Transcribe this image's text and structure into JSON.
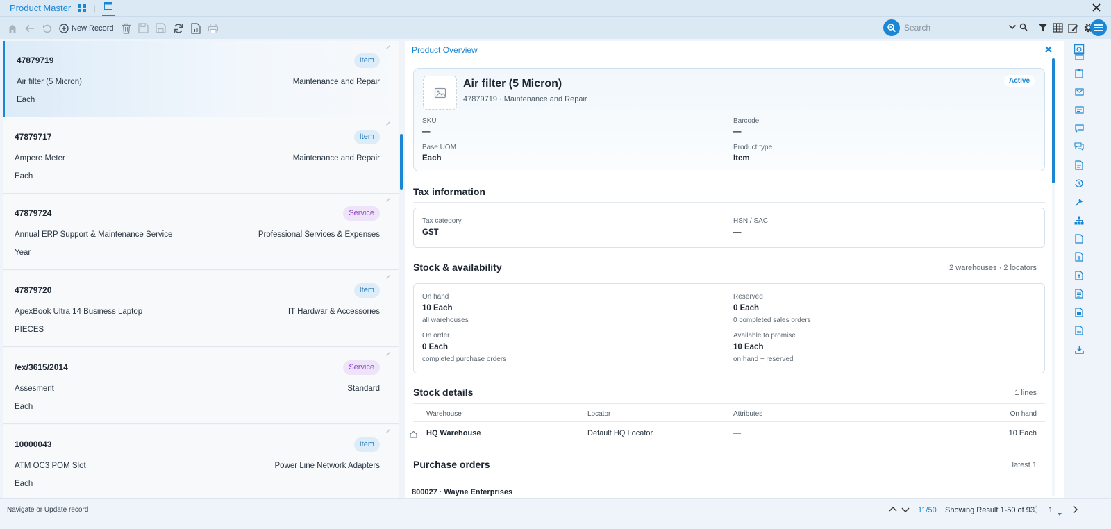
{
  "window": {
    "title": "Product Master"
  },
  "toolbar": {
    "new_record_label": "New Record",
    "search_placeholder": "Search"
  },
  "list": {
    "items": [
      {
        "code": "47879719",
        "type": "Item",
        "name": "Air filter (5 Micron)",
        "category": "Maintenance and Repair",
        "uom": "Each"
      },
      {
        "code": "47879717",
        "type": "Item",
        "name": "Ampere Meter",
        "category": "Maintenance and Repair",
        "uom": "Each"
      },
      {
        "code": "47879724",
        "type": "Service",
        "name": "Annual ERP Support & Maintenance Service",
        "category": "Professional Services & Expenses",
        "uom": "Year"
      },
      {
        "code": "47879720",
        "type": "Item",
        "name": "ApexBook Ultra 14 Business Laptop",
        "category": "IT Hardwar & Accessories",
        "uom": "PIECES"
      },
      {
        "code": "/ex/3615/2014",
        "type": "Service",
        "name": "Assesment",
        "category": "Standard",
        "uom": "Each"
      },
      {
        "code": "10000043",
        "type": "Item",
        "name": "ATM OC3 POM Slot",
        "category": "Power Line Network Adapters",
        "uom": "Each"
      }
    ]
  },
  "detail": {
    "panel_title": "Product Overview",
    "product": {
      "name": "Air filter (5 Micron)",
      "subtitle": "47879719 · Maintenance and Repair",
      "status": "Active",
      "sku_label": "SKU",
      "sku_value": "—",
      "barcode_label": "Barcode",
      "barcode_value": "—",
      "base_uom_label": "Base UOM",
      "base_uom_value": "Each",
      "product_type_label": "Product type",
      "product_type_value": "Item"
    },
    "tax": {
      "title": "Tax information",
      "category_label": "Tax category",
      "category_value": "GST",
      "hsn_label": "HSN / SAC",
      "hsn_value": "—"
    },
    "stock": {
      "title": "Stock & availability",
      "meta": "2 warehouses · 2 locators",
      "on_hand_label": "On hand",
      "on_hand_value": "10 Each",
      "on_hand_sub": "all warehouses",
      "reserved_label": "Reserved",
      "reserved_value": "0 Each",
      "reserved_sub": "0 completed sales orders",
      "on_order_label": "On order",
      "on_order_value": "0 Each",
      "on_order_sub": "completed purchase orders",
      "atp_label": "Available to promise",
      "atp_value": "10 Each",
      "atp_sub": "on hand − reserved"
    },
    "stock_details": {
      "title": "Stock details",
      "meta": "1 lines",
      "columns": [
        "Warehouse",
        "Locator",
        "Attributes",
        "On hand"
      ],
      "rows": [
        {
          "warehouse": "HQ Warehouse",
          "locator": "Default HQ Locator",
          "attributes": "—",
          "on_hand": "10 Each"
        }
      ]
    },
    "purchase_orders": {
      "title": "Purchase orders",
      "meta": "latest 1",
      "rows": [
        {
          "label": "800027 · Wayne Enterprises"
        }
      ]
    }
  },
  "status_bar": {
    "message": "Navigate or Update record",
    "record_position": "11/50",
    "result_text": "Showing Result 1-50 of 93",
    "page": "1"
  },
  "colors": {
    "accent": "#1a86d4",
    "service_badge": "#8a3fc7",
    "item_badge": "#1a6fb0"
  }
}
